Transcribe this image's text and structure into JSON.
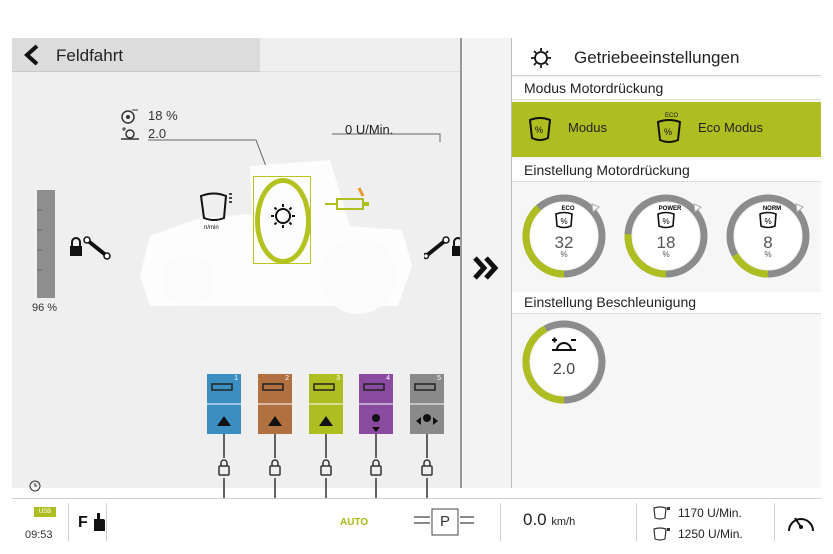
{
  "left": {
    "title": "Feldfahrt",
    "slip_value": "18 %",
    "mode_value": "2.0",
    "engine_rpm": "0 U/Min.",
    "gauge_percent": "96 %",
    "engine_label": "n/min",
    "hydraulics": [
      {
        "num": "1",
        "color": "#3a8fc0"
      },
      {
        "num": "2",
        "color": "#b07040"
      },
      {
        "num": "3",
        "color": "#aebd1f"
      },
      {
        "num": "4",
        "color": "#8a4aa0"
      },
      {
        "num": "5",
        "color": "#8a8a8a"
      }
    ]
  },
  "right": {
    "title": "Getriebeeinstellungen",
    "sections": {
      "motor_mode": "Modus Motordrückung",
      "motor_setting": "Einstellung Motordrückung",
      "acceleration": "Einstellung Beschleunigung"
    },
    "modes": {
      "modus_label": "Modus",
      "eco_label": "Eco Modus",
      "eco_tag": "ECO"
    },
    "dials": [
      {
        "tag": "ECO",
        "value": "32",
        "unit": "%",
        "level": 0.32
      },
      {
        "tag": "POWER",
        "value": "18",
        "unit": "%",
        "level": 0.18
      },
      {
        "tag": "NORM",
        "value": "8",
        "unit": "%",
        "level": 0.08
      }
    ],
    "accel_dial": {
      "value": "2.0",
      "level": 0.42
    }
  },
  "bottom": {
    "time": "09:53",
    "usb_label": "USB",
    "auto_label": "AUTO",
    "gear_label": "P",
    "speed_value": "0.0",
    "speed_unit": "km/h",
    "rpm1": "1170 U/Min.",
    "rpm2": "1250 U/Min."
  },
  "colors": {
    "accent": "#aebd1f",
    "panel_gray": "#efefef"
  }
}
